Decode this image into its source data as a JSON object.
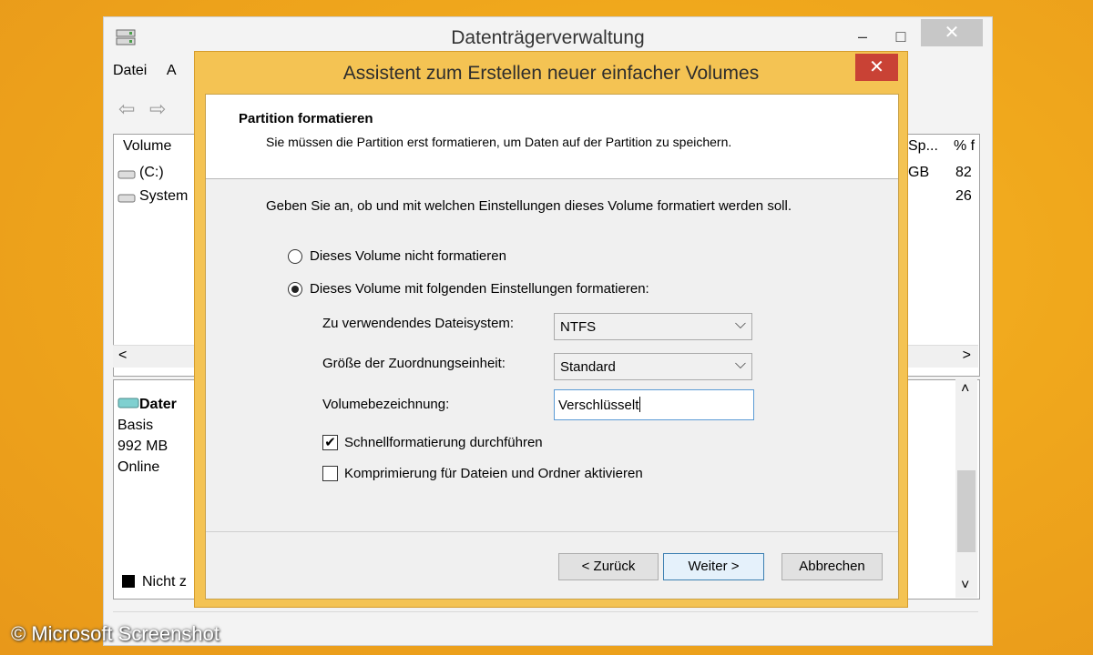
{
  "bgwindow": {
    "title": "Datenträgerverwaltung",
    "min_symbol": "–",
    "max_symbol": "□",
    "close_symbol": "✕",
    "menu": [
      "Datei",
      "A"
    ],
    "table": {
      "col_volume": "Volume",
      "col_space": "Sp...",
      "col_percent": "% f",
      "rows": [
        {
          "name": "(C:)",
          "space": "GB",
          "percent": "82"
        },
        {
          "name": "System",
          "space": "",
          "percent": "26"
        }
      ]
    },
    "scroll_left": "<",
    "scroll_right": ">",
    "scroll_up": "˄",
    "scroll_down": "˅",
    "disk": {
      "name": "Dater",
      "type": "Basis",
      "size": "992 MB",
      "status": "Online"
    },
    "legend": "Nicht z"
  },
  "dialog": {
    "title": "Assistent zum Erstellen neuer einfacher Volumes",
    "close_symbol": "✕",
    "header_title": "Partition formatieren",
    "header_subtitle": "Sie müssen die Partition erst formatieren, um Daten auf der Partition zu speichern.",
    "prompt": "Geben Sie an, ob und mit welchen Einstellungen dieses Volume formatiert werden soll.",
    "option_no_format": "Dieses Volume nicht formatieren",
    "option_format": "Dieses Volume mit folgenden Einstellungen formatieren:",
    "filesystem_label": "Zu verwendendes Dateisystem:",
    "filesystem_value": "NTFS",
    "alloc_label": "Größe der Zuordnungseinheit:",
    "alloc_value": "Standard",
    "volume_label_label": "Volumebezeichnung:",
    "volume_label_value": "Verschlüsselt",
    "quick_format_label": "Schnellformatierung durchführen",
    "compression_label": "Komprimierung für Dateien und Ordner aktivieren",
    "check_mark": "✔",
    "chevron": "⌵",
    "btn_back": "< Zurück",
    "btn_next": "Weiter >",
    "btn_cancel": "Abbrechen"
  },
  "watermark": "© Microsoft Screenshot",
  "state": {
    "format_selected": true,
    "quick_format_checked": true,
    "compression_checked": false
  }
}
